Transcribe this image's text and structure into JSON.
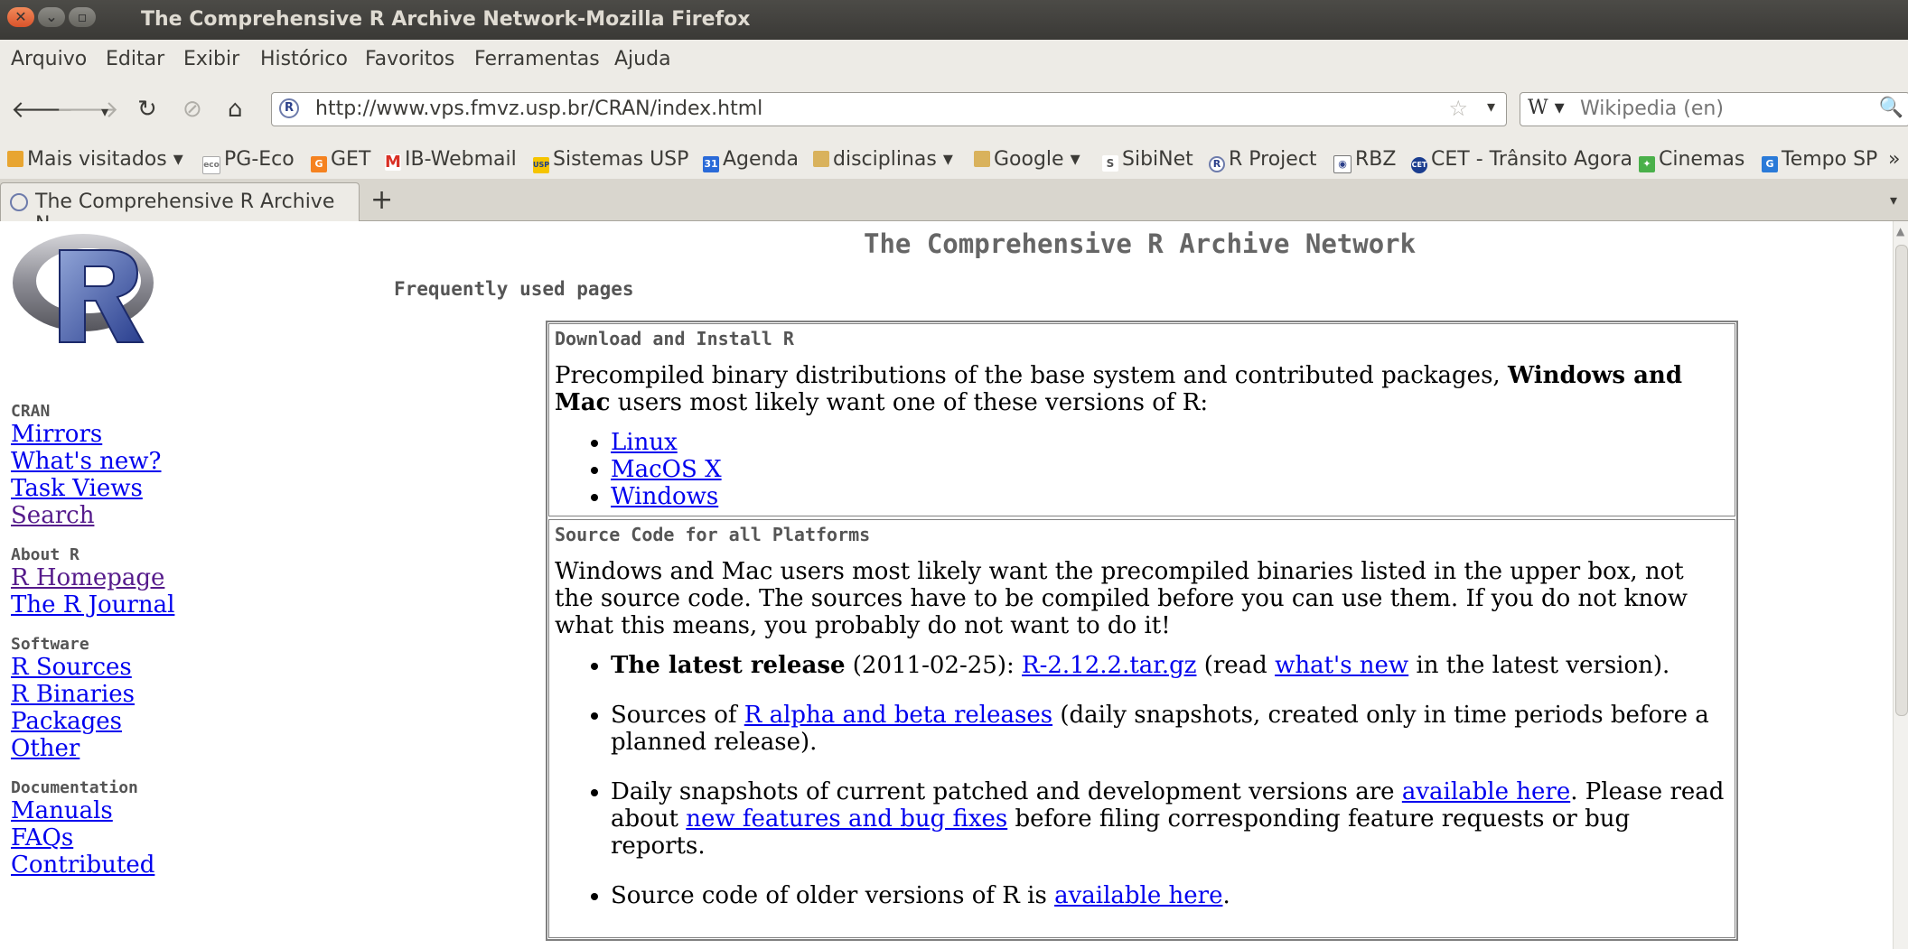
{
  "window": {
    "title": "The Comprehensive R Archive Network-Mozilla Firefox"
  },
  "menu": [
    "Arquivo",
    "Editar",
    "Exibir",
    "Histórico",
    "Favoritos",
    "Ferramentas",
    "Ajuda"
  ],
  "nav": {
    "url": "http://www.vps.fmvz.usp.br/CRAN/index.html",
    "search_engine": "W",
    "search_placeholder": "Wikipedia (en)"
  },
  "bookmarks": [
    {
      "label": "Mais visitados",
      "dropdown": true,
      "icon": "folder-icon"
    },
    {
      "label": "PG-Eco",
      "icon": "eco-icon"
    },
    {
      "label": "GET",
      "icon": "get-icon"
    },
    {
      "label": "IB-Webmail",
      "icon": "mail-icon"
    },
    {
      "label": "Sistemas USP",
      "icon": "usp-icon"
    },
    {
      "label": "Agenda",
      "icon": "calendar-icon"
    },
    {
      "label": "disciplinas",
      "dropdown": true,
      "icon": "folder-icon"
    },
    {
      "label": "Google",
      "dropdown": true,
      "icon": "folder-icon"
    },
    {
      "label": "SibiNet",
      "icon": "sibinet-icon"
    },
    {
      "label": "R Project",
      "icon": "r-icon"
    },
    {
      "label": "RBZ",
      "icon": "rbz-icon"
    },
    {
      "label": "CET - Trânsito Agora",
      "icon": "cet-icon"
    },
    {
      "label": "Cinemas",
      "icon": "cinemas-icon"
    },
    {
      "label": "Tempo SP",
      "icon": "tempo-icon"
    }
  ],
  "bookmarks_overflow": "»",
  "tab": {
    "label": "The Comprehensive R Archive N..."
  },
  "page": {
    "title": "The Comprehensive R Archive Network",
    "frequently": "Frequently used pages",
    "sidebar": [
      {
        "heading": "CRAN",
        "links": [
          {
            "label": "Mirrors"
          },
          {
            "label": "What's new?"
          },
          {
            "label": "Task Views"
          },
          {
            "label": "Search",
            "visited": true
          }
        ]
      },
      {
        "heading": "About R",
        "links": [
          {
            "label": "R Homepage",
            "visited": true
          },
          {
            "label": "The R Journal"
          }
        ]
      },
      {
        "heading": "Software",
        "links": [
          {
            "label": "R Sources"
          },
          {
            "label": "R Binaries"
          },
          {
            "label": "Packages"
          },
          {
            "label": "Other"
          }
        ]
      },
      {
        "heading": "Documentation",
        "links": [
          {
            "label": "Manuals"
          },
          {
            "label": "FAQs"
          },
          {
            "label": "Contributed"
          }
        ]
      }
    ],
    "download_box": {
      "heading": "Download and Install R",
      "intro_text": "Precompiled binary distributions of the base system and contributed packages, ",
      "intro_bold": "Windows and Mac",
      "intro_text2": " users most likely want one of these versions of R:",
      "links": [
        "Linux",
        "MacOS X",
        "Windows"
      ]
    },
    "source_box": {
      "heading": "Source Code for all Platforms",
      "intro": "Windows and Mac users most likely want the precompiled binaries listed in the upper box, not the source code. The sources have to be compiled before you can use them. If you do not know what this means, you probably do not want to do it!",
      "item1": {
        "bold": "The latest release",
        "t1": " (2011-02-25): ",
        "link1": "R-2.12.2.tar.gz",
        "t2": " (read ",
        "link2": "what's new",
        "t3": " in the latest version)."
      },
      "item2": {
        "t1": "Sources of ",
        "link1": "R alpha and beta releases",
        "t2": " (daily snapshots, created only in time periods before a planned release)."
      },
      "item3": {
        "t1": "Daily snapshots of current patched and development versions are ",
        "link1": "available here",
        "t2": ". Please read about ",
        "link2": "new features and bug fixes",
        "t3": " before filing corresponding feature requests or bug reports."
      },
      "item4": {
        "t1": "Source code of older versions of R is ",
        "link1": "available here",
        "t2": "."
      }
    }
  }
}
